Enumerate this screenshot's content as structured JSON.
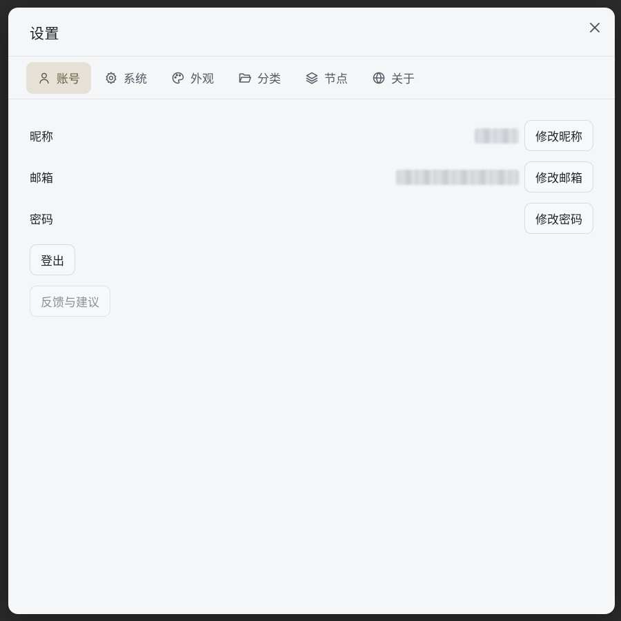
{
  "dialog": {
    "title": "设置"
  },
  "tabs": [
    {
      "label": "账号",
      "icon": "user-icon",
      "active": true
    },
    {
      "label": "系统",
      "icon": "gear-icon",
      "active": false
    },
    {
      "label": "外观",
      "icon": "palette-icon",
      "active": false
    },
    {
      "label": "分类",
      "icon": "folder-icon",
      "active": false
    },
    {
      "label": "节点",
      "icon": "layers-icon",
      "active": false
    },
    {
      "label": "关于",
      "icon": "globe-icon",
      "active": false
    }
  ],
  "account": {
    "nickname": {
      "label": "昵称",
      "button": "修改昵称"
    },
    "email": {
      "label": "邮箱",
      "button": "修改邮箱"
    },
    "password": {
      "label": "密码",
      "button": "修改密码"
    },
    "logout_button": "登出",
    "feedback_button": "反馈与建议"
  },
  "colors": {
    "active_tab_bg": "#e6e1d6",
    "active_tab_text": "#6b5f45",
    "dialog_bg": "#f5f6f8"
  }
}
